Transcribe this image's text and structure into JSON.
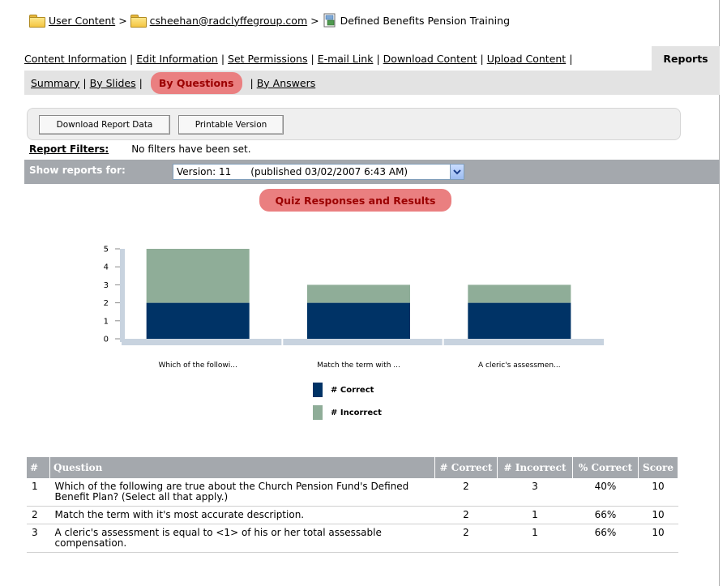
{
  "breadcrumb": {
    "root": "User Content",
    "user": "csheehan@radclyffegroup.com",
    "current": "Defined Benefits Pension Training",
    "separator": ">"
  },
  "tabs": {
    "items": [
      "Content Information",
      "Edit Information",
      "Set Permissions",
      "E-mail Link",
      "Download Content",
      "Upload Content"
    ],
    "active": "Reports"
  },
  "subtabs": {
    "summary": "Summary",
    "by_slides": "By Slides",
    "by_questions": "By Questions",
    "by_answers": "By Answers"
  },
  "toolbar": {
    "download": "Download Report Data",
    "printable": "Printable Version"
  },
  "filters": {
    "label": "Report Filters:",
    "value": "No filters have been set."
  },
  "show_reports": {
    "label": "Show reports for:",
    "version": "Version: 11",
    "published": "(published 03/02/2007 6:43 AM)"
  },
  "chart_title": "Quiz Responses and Results",
  "chart_data": {
    "type": "bar",
    "stacked": true,
    "categories": [
      "Which of the followi...",
      "Match the term with ...",
      "A cleric's assessmen..."
    ],
    "series": [
      {
        "name": "# Correct",
        "values": [
          2,
          2,
          2
        ],
        "color": "#003366"
      },
      {
        "name": "# Incorrect",
        "values": [
          3,
          1,
          1
        ],
        "color": "#8fad98"
      }
    ],
    "ylim": [
      0,
      5
    ],
    "yticks": [
      "0",
      "1",
      "2",
      "3",
      "4",
      "5"
    ],
    "grid": false,
    "legend": "bottom"
  },
  "table": {
    "headers": [
      "#",
      "Question",
      "# Correct",
      "# Incorrect",
      "% Correct",
      "Score"
    ],
    "rows": [
      {
        "num": "1",
        "question": "Which of the following are true about the Church Pension Fund's Defined Benefit Plan? (Select all that apply.)",
        "correct": "2",
        "incorrect": "3",
        "pct": "40%",
        "score": "10"
      },
      {
        "num": "2",
        "question": "Match the term with it's most accurate description.",
        "correct": "2",
        "incorrect": "1",
        "pct": "66%",
        "score": "10"
      },
      {
        "num": "3",
        "question": "A cleric's assessment is equal to <1> of his or her total assessable compensation.",
        "correct": "2",
        "incorrect": "1",
        "pct": "66%",
        "score": "10"
      }
    ]
  }
}
